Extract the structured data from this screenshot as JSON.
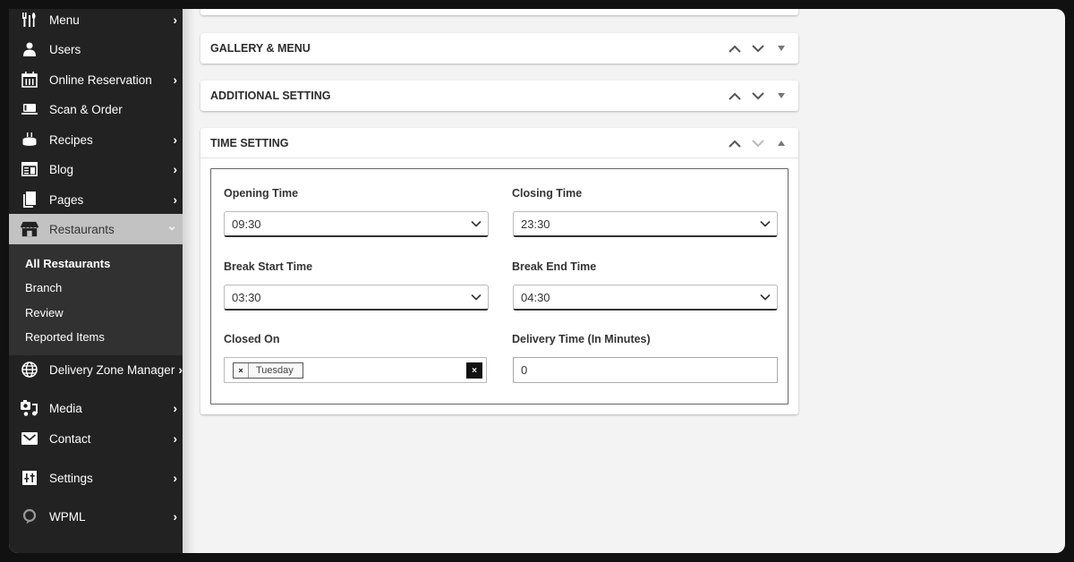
{
  "sidebar": {
    "items": [
      {
        "label": "Menu",
        "icon": "cutlery-icon",
        "has_submenu": true
      },
      {
        "label": "Users",
        "icon": "user-icon",
        "has_submenu": false
      },
      {
        "label": "Online Reservation",
        "icon": "calendar-icon",
        "has_submenu": true
      },
      {
        "label": "Scan & Order",
        "icon": "scan-order-icon",
        "has_submenu": false
      },
      {
        "label": "Recipes",
        "icon": "cake-icon",
        "has_submenu": true
      },
      {
        "label": "Blog",
        "icon": "blog-icon",
        "has_submenu": true
      },
      {
        "label": "Pages",
        "icon": "pages-icon",
        "has_submenu": true
      },
      {
        "label": "Restaurants",
        "icon": "store-icon",
        "has_submenu": true,
        "active": true
      },
      {
        "label": "Delivery Zone Manager",
        "icon": "globe-icon",
        "has_submenu": true
      },
      {
        "label": "Media",
        "icon": "media-icon",
        "has_submenu": true
      },
      {
        "label": "Contact",
        "icon": "envelope-icon",
        "has_submenu": true
      },
      {
        "label": "Settings",
        "icon": "settings-icon",
        "has_submenu": true
      },
      {
        "label": "WPML",
        "icon": "wpml-icon",
        "has_submenu": true
      }
    ],
    "submenu": [
      {
        "label": "All Restaurants",
        "current": true
      },
      {
        "label": "Branch"
      },
      {
        "label": "Review"
      },
      {
        "label": "Reported Items"
      }
    ],
    "chevron_right": "›",
    "chevron_down": "⌄"
  },
  "panels": {
    "gallery": {
      "title": "GALLERY & MENU",
      "expanded": false
    },
    "additional": {
      "title": "ADDITIONAL SETTING",
      "expanded": false
    },
    "time": {
      "title": "TIME SETTING",
      "expanded": true,
      "fields": {
        "opening_time": {
          "label": "Opening Time",
          "value": "09:30"
        },
        "closing_time": {
          "label": "Closing Time",
          "value": "23:30"
        },
        "break_start": {
          "label": "Break Start Time",
          "value": "03:30"
        },
        "break_end": {
          "label": "Break End Time",
          "value": "04:30"
        },
        "closed_on": {
          "label": "Closed On",
          "tags": [
            "Tuesday"
          ],
          "remove_glyph": "×",
          "clear_glyph": "×"
        },
        "delivery_time": {
          "label": "Delivery Time (In Minutes)",
          "value": "0"
        }
      }
    }
  }
}
